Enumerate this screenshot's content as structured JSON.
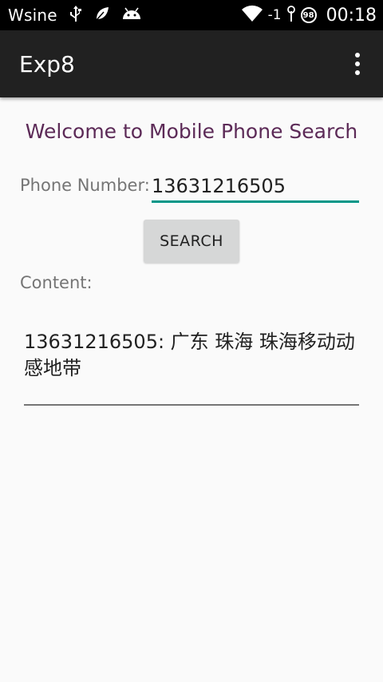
{
  "status_bar": {
    "carrier": "Wsine",
    "icons_left": [
      "usb-icon",
      "leaf-icon",
      "android-icon"
    ],
    "signal_text": "-1",
    "battery_level": "98",
    "time": "00:18"
  },
  "app_bar": {
    "title": "Exp8",
    "overflow_icon": "overflow-menu-icon"
  },
  "main": {
    "welcome_text": "Welcome to Mobile Phone Search",
    "phone_label": "Phone Number:",
    "phone_value": "13631216505",
    "search_button_label": "SEARCH",
    "content_label": "Content:",
    "content_text": "13631216505: 广东 珠海 珠海移动动感地带"
  },
  "colors": {
    "accent": "#009688",
    "welcome_text": "#5c2a57",
    "app_bar": "#212121",
    "status_bar": "#000000",
    "background": "#fafafa"
  }
}
